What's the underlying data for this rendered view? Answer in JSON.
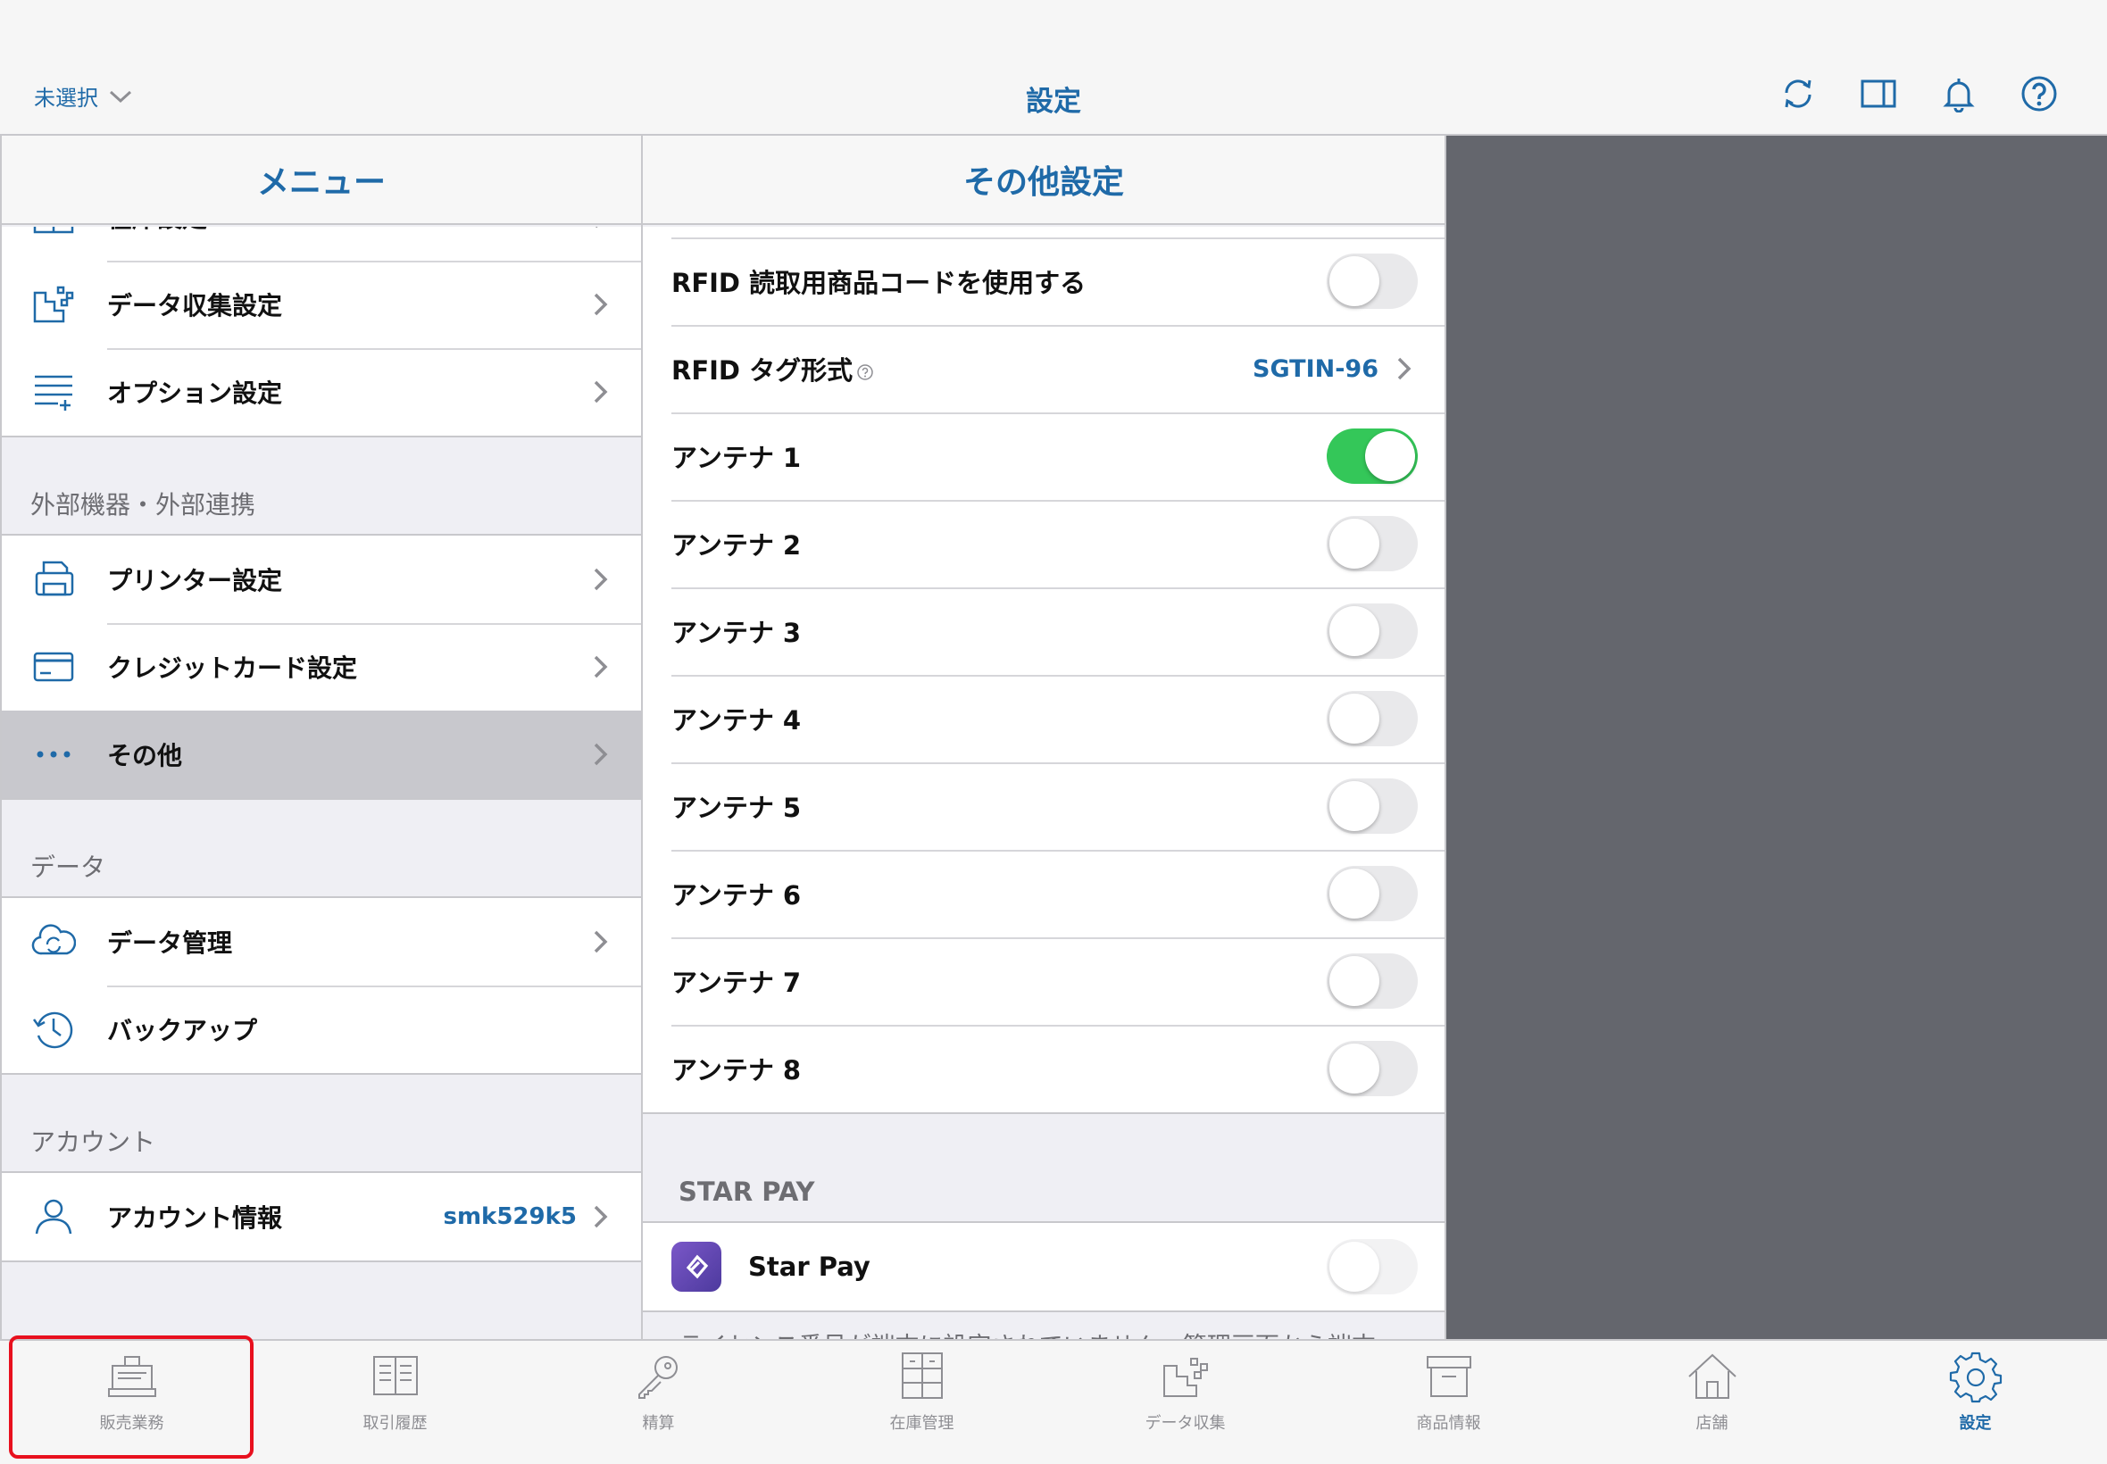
{
  "top": {
    "store_label": "未選択",
    "title": "設定",
    "icons": [
      "sync-icon",
      "split-view-icon",
      "bell-icon",
      "help-icon"
    ]
  },
  "menu": {
    "header": "メニュー",
    "groups": [
      {
        "section": "",
        "items": [
          {
            "label": "在庫設定",
            "icon": "inventory-icon"
          },
          {
            "label": "データ収集設定",
            "icon": "data-collect-icon"
          },
          {
            "label": "オプション設定",
            "icon": "list-plus-icon"
          }
        ]
      },
      {
        "section": "外部機器・外部連携",
        "items": [
          {
            "label": "プリンター設定",
            "icon": "printer-icon"
          },
          {
            "label": "クレジットカード設定",
            "icon": "credit-card-icon"
          },
          {
            "label": "その他",
            "icon": "more-dots-icon",
            "selected": true
          }
        ]
      },
      {
        "section": "データ",
        "items": [
          {
            "label": "データ管理",
            "icon": "cloud-sync-icon"
          },
          {
            "label": "バックアップ",
            "icon": "clock-history-icon"
          }
        ]
      },
      {
        "section": "アカウント",
        "items": [
          {
            "label": "アカウント情報",
            "icon": "user-icon",
            "value": "smk529k5"
          }
        ]
      }
    ]
  },
  "other_settings": {
    "header": "その他設定",
    "rows": [
      {
        "label": "RFID 読取用商品コードを使用する",
        "type": "toggle",
        "on": false
      },
      {
        "label": "RFID タグ形式",
        "type": "value",
        "value": "SGTIN-96",
        "help": true
      },
      {
        "label": "アンテナ 1",
        "type": "toggle",
        "on": true
      },
      {
        "label": "アンテナ 2",
        "type": "toggle",
        "on": false
      },
      {
        "label": "アンテナ 3",
        "type": "toggle",
        "on": false
      },
      {
        "label": "アンテナ 4",
        "type": "toggle",
        "on": false
      },
      {
        "label": "アンテナ 5",
        "type": "toggle",
        "on": false
      },
      {
        "label": "アンテナ 6",
        "type": "toggle",
        "on": false
      },
      {
        "label": "アンテナ 7",
        "type": "toggle",
        "on": false
      },
      {
        "label": "アンテナ 8",
        "type": "toggle",
        "on": false
      }
    ],
    "star_pay": {
      "section": "STAR PAY",
      "label": "Star Pay",
      "on": false,
      "footnote": "ライセンス番号が端末に設定されていません。管理画面から端末"
    }
  },
  "tabbar": {
    "tabs": [
      {
        "label": "販売業務",
        "icon": "register-icon"
      },
      {
        "label": "取引履歴",
        "icon": "book-icon"
      },
      {
        "label": "精算",
        "icon": "key-icon"
      },
      {
        "label": "在庫管理",
        "icon": "cabinet-icon"
      },
      {
        "label": "データ収集",
        "icon": "data-collect-icon"
      },
      {
        "label": "商品情報",
        "icon": "box-icon"
      },
      {
        "label": "店舗",
        "icon": "house-icon"
      },
      {
        "label": "設定",
        "icon": "gear-icon",
        "active": true
      }
    ]
  },
  "colors": {
    "accent": "#1f6aa8",
    "toggle_on": "#34c759",
    "highlight": "#e8101e",
    "detail_bg": "#64666d"
  }
}
